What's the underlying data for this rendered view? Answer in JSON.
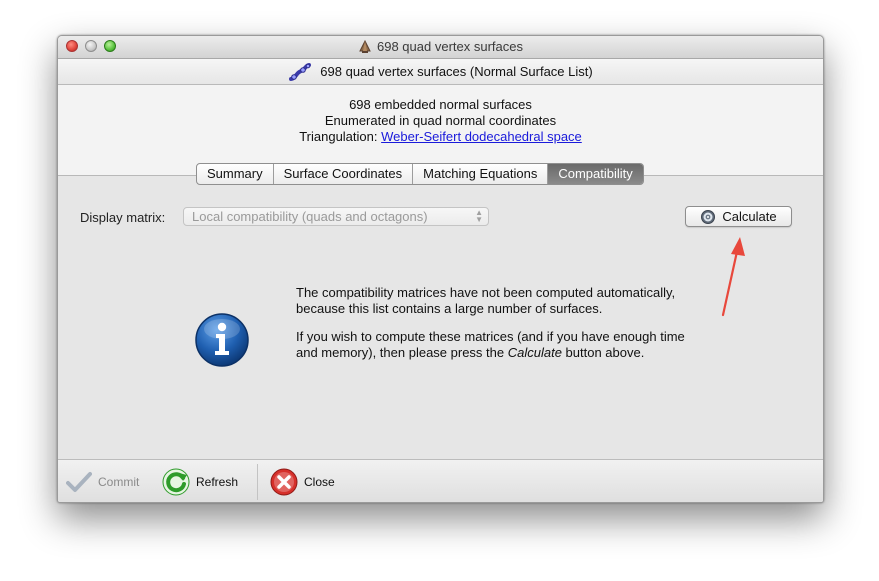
{
  "window": {
    "title": "698 quad vertex surfaces"
  },
  "subheader": {
    "text": "698 quad vertex surfaces (Normal Surface List)"
  },
  "info": {
    "line1": "698 embedded normal surfaces",
    "line2": "Enumerated in quad normal coordinates",
    "triangulation_label": "Triangulation:",
    "triangulation_link": "Weber-Seifert dodecahedral space"
  },
  "tabs": [
    {
      "label": "Summary",
      "active": false
    },
    {
      "label": "Surface Coordinates",
      "active": false
    },
    {
      "label": "Matching Equations",
      "active": false
    },
    {
      "label": "Compatibility",
      "active": true
    }
  ],
  "display_matrix": {
    "label": "Display matrix:",
    "selected": "Local compatibility (quads and octagons)"
  },
  "calculate_button": {
    "label": "Calculate",
    "icon": "gear-icon"
  },
  "message": {
    "para1": "The compatibility matrices have not been computed automatically, because this list contains a large number of surfaces.",
    "para2_before": "If you wish to compute these matrices (and if you have enough time and memory), then please press the ",
    "para2_emph": "Calculate",
    "para2_after": " button above.",
    "icon": "info-icon"
  },
  "footer": {
    "commit": "Commit",
    "refresh": "Refresh",
    "close": "Close"
  },
  "colors": {
    "link": "#1a1adb",
    "active_tab": "#7a7a7a",
    "info_icon": "#1f5fb0",
    "close_icon": "#d6302b",
    "refresh_icon": "#2e9b2a",
    "annotation_arrow": "#e8483c"
  }
}
